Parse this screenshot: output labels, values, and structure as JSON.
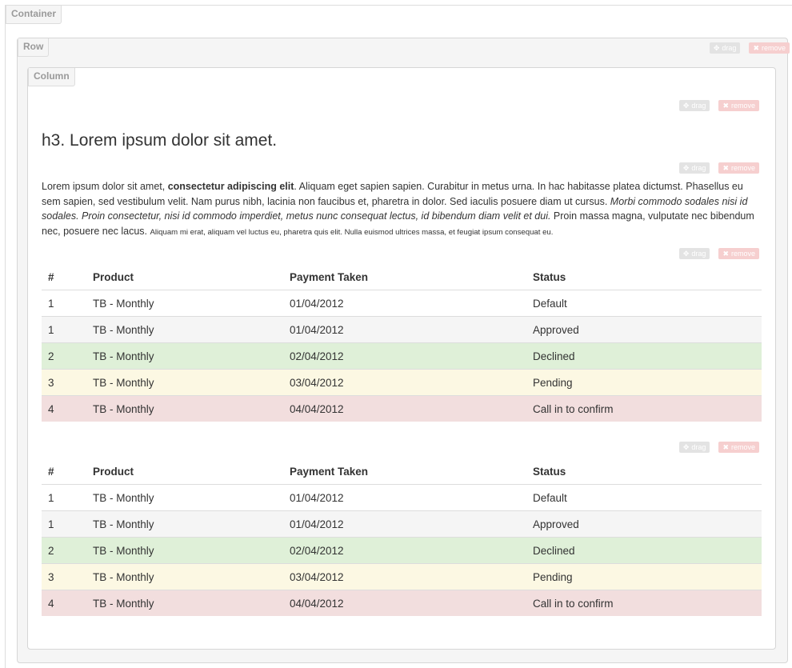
{
  "labels": {
    "container": "Container",
    "row": "Row",
    "column": "Column"
  },
  "controls": {
    "drag_label": "drag",
    "remove_label": "remove",
    "drag_icon": "move-icon",
    "remove_icon": "x-icon"
  },
  "heading": "h3. Lorem ipsum dolor sit amet.",
  "paragraph": {
    "t1": "Lorem ipsum dolor sit amet, ",
    "bold": "consectetur adipiscing elit",
    "t2": ". Aliquam eget sapien sapien. Curabitur in metus urna. In hac habitasse platea dictumst. Phasellus eu sem sapien, sed vestibulum velit. Nam purus nibh, lacinia non faucibus et, pharetra in dolor. Sed iaculis posuere diam ut cursus. ",
    "italic": "Morbi commodo sodales nisi id sodales. Proin consectetur, nisi id commodo imperdiet, metus nunc consequat lectus, id bibendum diam velit et dui.",
    "t3": " Proin massa magna, vulputate nec bibendum nec, posuere nec lacus. ",
    "small": "Aliquam mi erat, aliquam vel luctus eu, pharetra quis elit. Nulla euismod ultrices massa, et feugiat ipsum consequat eu."
  },
  "table": {
    "headers": [
      "#",
      "Product",
      "Payment Taken",
      "Status"
    ],
    "rows": [
      {
        "num": "1",
        "product": "TB - Monthly",
        "payment": "01/04/2012",
        "status": "Default"
      },
      {
        "num": "1",
        "product": "TB - Monthly",
        "payment": "01/04/2012",
        "status": "Approved"
      },
      {
        "num": "2",
        "product": "TB - Monthly",
        "payment": "02/04/2012",
        "status": "Declined"
      },
      {
        "num": "3",
        "product": "TB - Monthly",
        "payment": "03/04/2012",
        "status": "Pending"
      },
      {
        "num": "4",
        "product": "TB - Monthly",
        "payment": "04/04/2012",
        "status": "Call in to confirm"
      }
    ],
    "row_colors": [
      "#ffffff",
      "#f5f5f5",
      "#dff0d8",
      "#fcf8e3",
      "#f2dede"
    ]
  }
}
